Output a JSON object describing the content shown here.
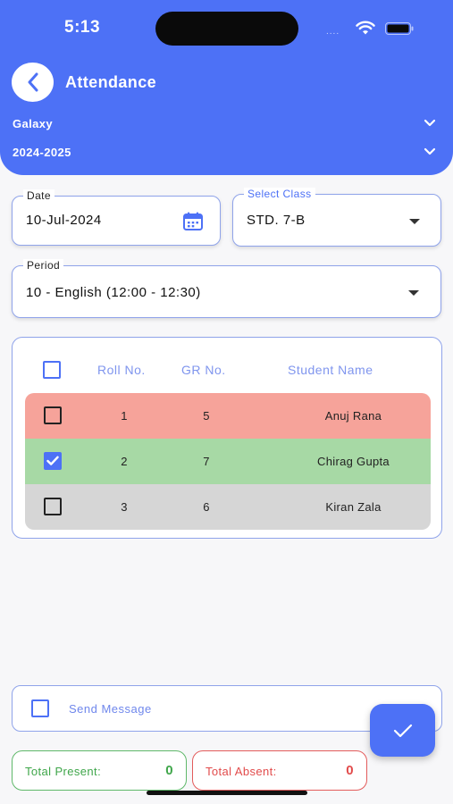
{
  "status_bar": {
    "time": "5:13",
    "dots": "....",
    "icons": [
      "wifi-icon",
      "battery-icon"
    ]
  },
  "header": {
    "title": "Attendance",
    "back_icon": "chevron-left-icon",
    "school": "Galaxy",
    "year": "2024-2025"
  },
  "form": {
    "date_label": "Date",
    "date_value": "10-Jul-2024",
    "date_icon": "calendar-icon",
    "class_label": "Select Class",
    "class_value": "STD. 7-B",
    "period_label": "Period",
    "period_value": "10 - English (12:00 - 12:30)"
  },
  "table": {
    "headers": {
      "roll": "Roll No.",
      "gr": "GR No.",
      "name": "Student Name"
    },
    "rows": [
      {
        "roll": "1",
        "gr": "5",
        "name": "Anuj Rana",
        "checked": false,
        "status": "absent"
      },
      {
        "roll": "2",
        "gr": "7",
        "name": "Chirag Gupta",
        "checked": true,
        "status": "present"
      },
      {
        "roll": "3",
        "gr": "6",
        "name": "Kiran Zala",
        "checked": false,
        "status": "unmarked"
      }
    ]
  },
  "send_message": {
    "label": "Send Message",
    "checked": false
  },
  "fab": {
    "icon": "check-icon"
  },
  "totals": {
    "present_label": "Total Present:",
    "present_value": "0",
    "absent_label": "Total Absent:",
    "absent_value": "0"
  },
  "colors": {
    "primary": "#4d71f6",
    "absent_row": "#f6a39a",
    "present_row": "#a7d9a5",
    "unmarked_row": "#d6d6d6",
    "present_text": "#3fa64a",
    "absent_text": "#e24b4b"
  }
}
